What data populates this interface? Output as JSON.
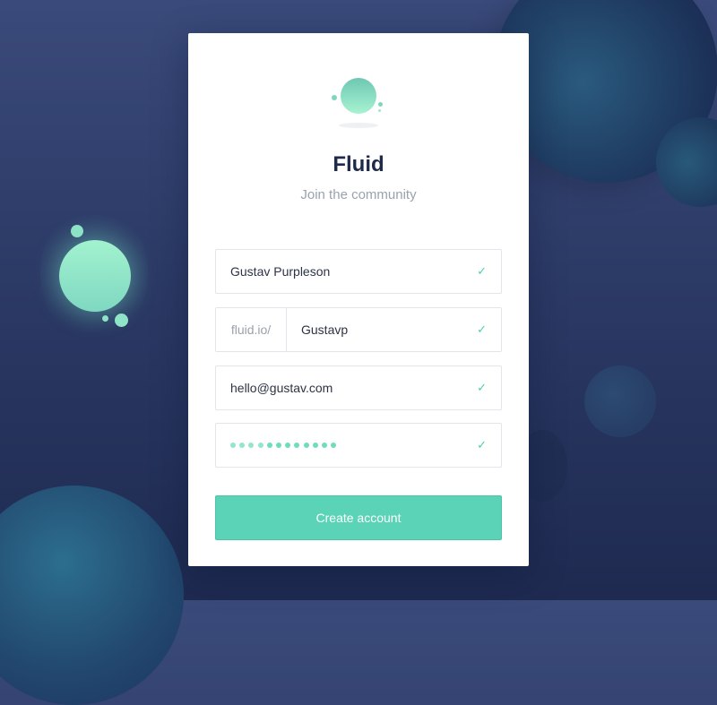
{
  "app": {
    "title": "Fluid",
    "subtitle": "Join the community"
  },
  "form": {
    "full_name": {
      "value": "Gustav Purpleson",
      "status_icon": "check-icon"
    },
    "username": {
      "prefix": "fluid.io/",
      "value": "Gustavp",
      "status_icon": "check-icon"
    },
    "email": {
      "value": "hello@gustav.com",
      "status_icon": "check-icon"
    },
    "password": {
      "masked_length": 12,
      "status_icon": "check-icon"
    },
    "check_glyph": "✓",
    "submit_label": "Create account"
  },
  "colors": {
    "accent": "#5ad3b6",
    "title": "#1d2a4a",
    "muted": "#9aa2ad",
    "background_top": "#3a4a7a",
    "background_bottom": "#1e2a50"
  }
}
